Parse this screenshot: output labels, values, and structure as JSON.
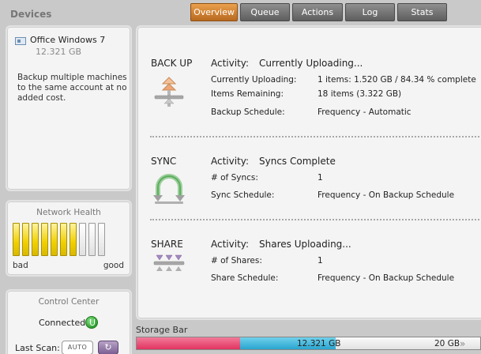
{
  "sidebar": {
    "devices_title": "Devices",
    "device": {
      "name": "Office Windows 7",
      "size": "12.321 GB",
      "icon": "computer-icon"
    },
    "note": "Backup multiple machines to the same account at no added cost.",
    "health": {
      "title": "Network Health",
      "bars_total": 10,
      "bars_on": 7,
      "bad_label": "bad",
      "good_label": "good",
      "on_color": "#f0d000"
    },
    "control": {
      "title": "Control Center",
      "status": "Connected",
      "last_scan_label": "Last Scan:",
      "auto_label": "AUTO",
      "refresh_icon": "refresh-icon"
    }
  },
  "tabs": [
    {
      "label": "Overview",
      "active": true
    },
    {
      "label": "Queue",
      "active": false
    },
    {
      "label": "Actions",
      "active": false
    },
    {
      "label": "Log",
      "active": false
    },
    {
      "label": "Stats",
      "active": false
    }
  ],
  "main": {
    "activity_label": "Activity:",
    "backup": {
      "title": "BACK UP",
      "activity": "Currently Uploading...",
      "rows": [
        {
          "label": "Currently Uploading:",
          "value": "1 items: 1.520 GB / 84.34 % complete"
        },
        {
          "label": "Items Remaining:",
          "value": "18 items (3.322 GB)"
        },
        {
          "label": "Backup Schedule:",
          "value": "Frequency - Automatic"
        }
      ]
    },
    "sync": {
      "title": "SYNC",
      "activity": "Syncs Complete",
      "rows": [
        {
          "label": "# of Syncs:",
          "value": "1"
        },
        {
          "label": "Sync Schedule:",
          "value": "Frequency - On Backup Schedule"
        }
      ]
    },
    "share": {
      "title": "SHARE",
      "activity": "Shares Uploading...",
      "rows": [
        {
          "label": "# of Shares:",
          "value": "1"
        },
        {
          "label": "Share Schedule:",
          "value": "Frequency - On Backup Schedule"
        }
      ]
    }
  },
  "storage": {
    "label": "Storage Bar",
    "used": "12.321 GB",
    "total": "20 GB",
    "fractions": {
      "pink": 0.3,
      "blue": 0.28,
      "gray": 0.0,
      "free": 0.42
    },
    "colors": {
      "pink": "#e0345f",
      "blue": "#2aa5cf"
    }
  },
  "colors": {
    "accent_tab": "#d48234",
    "panel_bg": "#f4f4f4",
    "window_bg": "#c9c9c9"
  }
}
